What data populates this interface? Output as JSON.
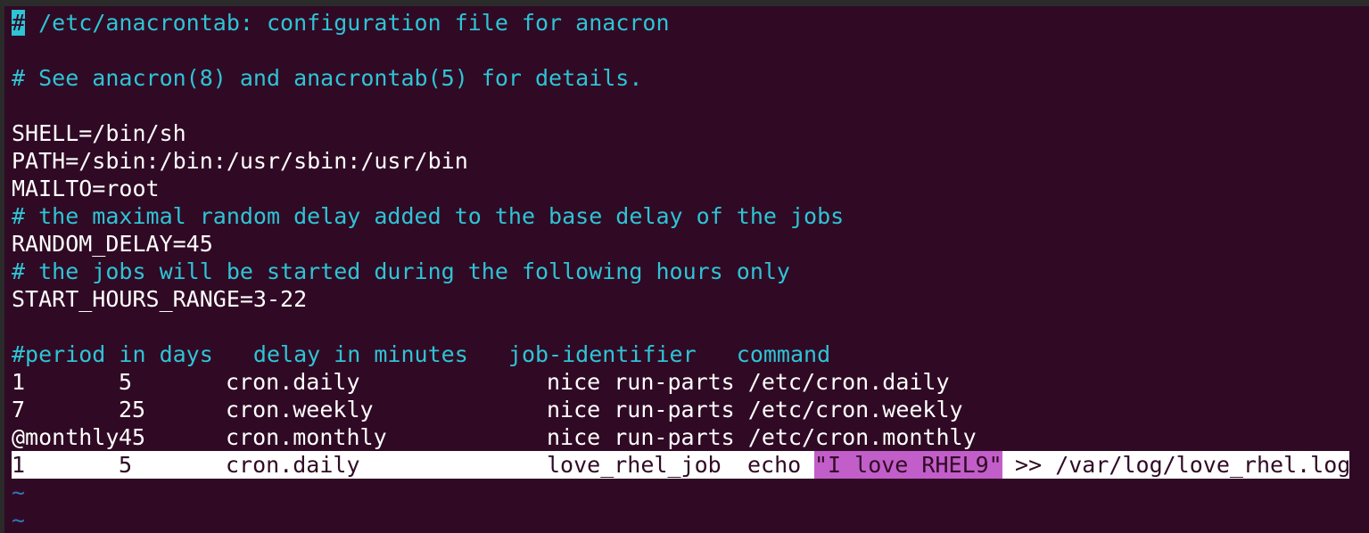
{
  "editor": {
    "line1_cursor": "#",
    "line1_rest": " /etc/anacrontab: configuration file for anacron",
    "line2": "# See anacron(8) and anacrontab(5) for details.",
    "shell": "SHELL=/bin/sh",
    "path": "PATH=/sbin:/bin:/usr/sbin:/usr/bin",
    "mailto": "MAILTO=root",
    "comment_delay": "# the maximal random delay added to the base delay of the jobs",
    "random_delay": "RANDOM_DELAY=45",
    "comment_hours": "# the jobs will be started during the following hours only",
    "start_hours": "START_HOURS_RANGE=3-22",
    "header": "#period in days   delay in minutes   job-identifier   command",
    "jobs": [
      {
        "period": "1",
        "delay": "5",
        "id": "cron.daily",
        "command": "nice run-parts /etc/cron.daily"
      },
      {
        "period": "7",
        "delay": "25",
        "id": "cron.weekly",
        "command": "nice run-parts /etc/cron.weekly"
      },
      {
        "period": "@monthly",
        "delay": "45",
        "id": "cron.monthly",
        "command": "nice run-parts /etc/cron.monthly"
      }
    ],
    "selected_job": {
      "period": "1",
      "delay": "5",
      "id": "cron.daily",
      "job_identifier": "love_rhel_job",
      "echo": "echo",
      "string": "\"I love RHEL9\"",
      "redirect": " >> /var/log/love_rhel.log"
    },
    "tilde": "~"
  },
  "colors": {
    "background": "#300a24",
    "comment": "#2ec4d6",
    "string_highlight": "#c25ec9",
    "tilde": "#2f78b8"
  }
}
